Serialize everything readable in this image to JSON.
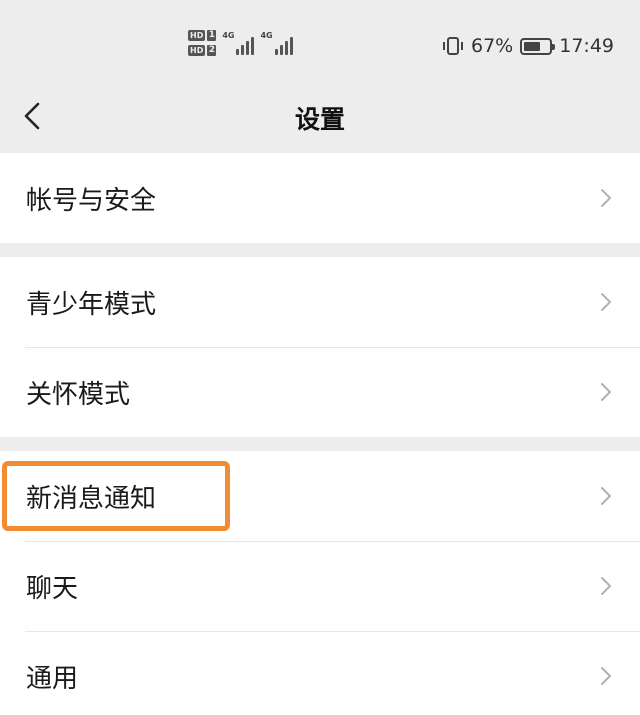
{
  "status_bar": {
    "sim1_hd": "HD",
    "sim1_slot": "1",
    "sim2_hd": "HD",
    "sim2_slot": "2",
    "net1_label": "4G",
    "net2_label": "4G",
    "battery_percent": "67%",
    "battery_level": 0.67,
    "time": "17:49",
    "icons": [
      "vibrate-icon",
      "battery-icon",
      "signal-icon"
    ]
  },
  "header": {
    "title": "设置",
    "back_icon": "chevron-left-icon"
  },
  "groups": [
    {
      "items": [
        {
          "label": "帐号与安全"
        }
      ]
    },
    {
      "items": [
        {
          "label": "青少年模式"
        },
        {
          "label": "关怀模式"
        }
      ]
    },
    {
      "items": [
        {
          "label": "新消息通知"
        },
        {
          "label": "聊天"
        },
        {
          "label": "通用"
        }
      ]
    }
  ],
  "highlight": {
    "target": "新消息通知",
    "color": "#f28c33"
  },
  "colors": {
    "background": "#ededed",
    "card": "#ffffff",
    "divider": "#e6e6e6",
    "chevron": "#b2b2b2"
  }
}
